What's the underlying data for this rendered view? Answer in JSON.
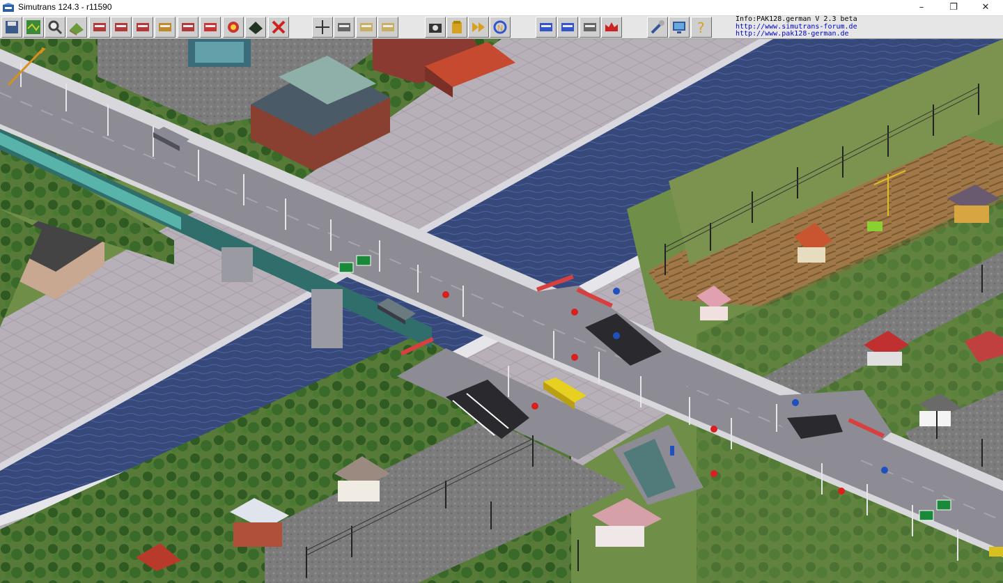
{
  "window": {
    "title": "Simutrans 124.3 - r11590",
    "minimize": "–",
    "maximize": "❐",
    "close": "✕"
  },
  "toolbar": {
    "tools": [
      {
        "name": "save-icon",
        "color": "#3b5a8a"
      },
      {
        "name": "map-icon",
        "color": "#3a8a3a"
      },
      {
        "name": "magnifier-icon",
        "color": "#444444"
      },
      {
        "name": "terrain-icon",
        "color": "#8a6a3a"
      },
      {
        "name": "rail-icon",
        "color": "#b33a3a"
      },
      {
        "name": "monorail-icon",
        "color": "#b33a3a"
      },
      {
        "name": "tram-icon",
        "color": "#b33a3a"
      },
      {
        "name": "road-icon",
        "color": "#c08a2a"
      },
      {
        "name": "ship-icon",
        "color": "#b33a3a"
      },
      {
        "name": "airplane-icon",
        "color": "#cc3333"
      },
      {
        "name": "special-icon",
        "color": "#cc3333"
      },
      {
        "name": "landscape-icon",
        "color": "#223322"
      },
      {
        "name": "remove-icon",
        "color": "#cc2222"
      },
      {
        "name": "cursor-icon",
        "color": "#333333"
      },
      {
        "name": "list-icon",
        "color": "#666666"
      },
      {
        "name": "sign-icon",
        "color": "#c8b060"
      },
      {
        "name": "line-icon",
        "color": "#c8b060"
      },
      {
        "name": "camera-icon",
        "color": "#333333"
      },
      {
        "name": "money-icon",
        "color": "#d8a020"
      },
      {
        "name": "fast-forward-icon",
        "color": "#d8a020"
      },
      {
        "name": "rotate-icon",
        "color": "#3355cc"
      },
      {
        "name": "windows-icon",
        "color": "#3355cc"
      },
      {
        "name": "player-icon",
        "color": "#3355cc"
      },
      {
        "name": "stats-icon",
        "color": "#666666"
      },
      {
        "name": "crown-icon",
        "color": "#cc2222"
      },
      {
        "name": "settings-icon",
        "color": "#335599"
      },
      {
        "name": "display-icon",
        "color": "#335599"
      },
      {
        "name": "help-icon",
        "color": "#d8a020"
      }
    ]
  },
  "info": {
    "line1": "Info:PAK128.german  V 2.3  beta",
    "line2": "http://www.simutrans-forum.de",
    "line3": "http://www.pak128-german.de"
  },
  "palette": {
    "grass": "#6f8f48",
    "road": "#8c8c94",
    "water": "#3a4e7a",
    "embankment": "#b8b0b8",
    "bridge": "#a6a6ae"
  }
}
